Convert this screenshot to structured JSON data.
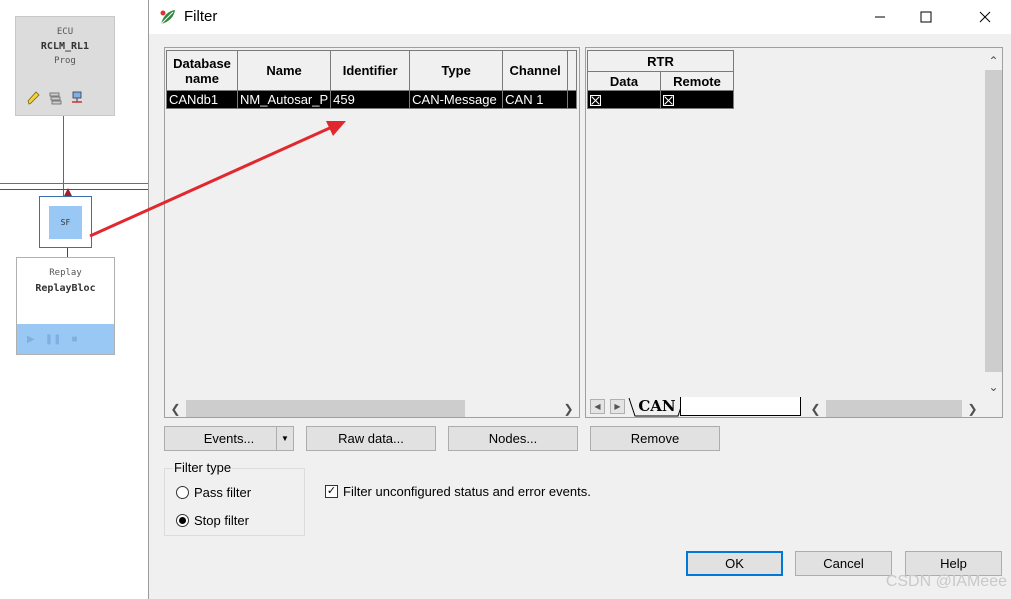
{
  "canvas": {
    "ecu": {
      "type_label": "ECU",
      "name": "RCLM_RL1",
      "mode": "Prog"
    },
    "sf_block": {
      "label": "SF"
    },
    "replay": {
      "type_label": "Replay",
      "name": "ReplayBloc"
    }
  },
  "dialog": {
    "title": "Filter",
    "left_grid": {
      "columns": [
        "Database name",
        "Name",
        "Identifier",
        "Type",
        "Channel"
      ],
      "rows": [
        {
          "database": "CANdb1",
          "name": "NM_Autosar_P",
          "identifier": "459",
          "type": "CAN-Message",
          "channel": "CAN 1"
        }
      ]
    },
    "right_grid": {
      "group_header": "RTR",
      "columns": [
        "Data",
        "Remote"
      ],
      "rows": [
        {
          "data": true,
          "remote": true
        }
      ]
    },
    "tab_label": "CAN",
    "buttons": {
      "events": "Events...",
      "raw_data": "Raw data...",
      "nodes": "Nodes...",
      "remove": "Remove",
      "ok": "OK",
      "cancel": "Cancel",
      "help": "Help"
    },
    "filter_type": {
      "label": "Filter type",
      "options": [
        "Pass filter",
        "Stop filter"
      ],
      "selected": "Stop filter"
    },
    "filter_unconfigured": {
      "label": "Filter unconfigured status and error events.",
      "checked": true
    }
  },
  "watermark": "CSDN @IAMeee",
  "colors": {
    "annotation_arrow": "#e0282e",
    "selection_row": "#000000",
    "block_blue": "#9ac8f5",
    "primary_border": "#0078d7"
  }
}
